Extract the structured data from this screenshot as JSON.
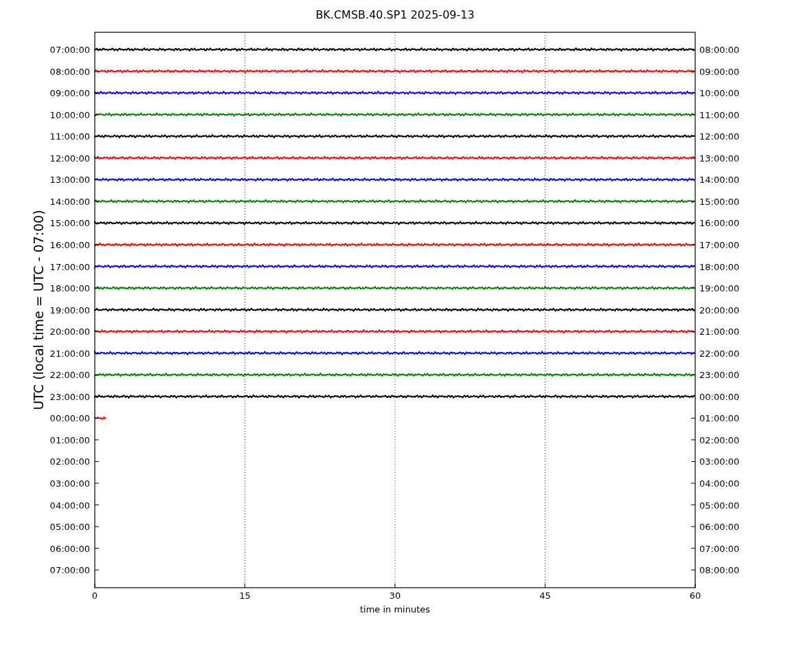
{
  "title": "BK.CMSB.40.SP1 2025-09-13",
  "ylabel": "UTC (local time = UTC - 07:00)",
  "xlabel": "time in minutes",
  "xticks": [
    "0",
    "15",
    "30",
    "45",
    "60"
  ],
  "left_ticks": [
    "07:00:00",
    "08:00:00",
    "09:00:00",
    "10:00:00",
    "11:00:00",
    "12:00:00",
    "13:00:00",
    "14:00:00",
    "15:00:00",
    "16:00:00",
    "17:00:00",
    "18:00:00",
    "19:00:00",
    "20:00:00",
    "21:00:00",
    "22:00:00",
    "23:00:00",
    "00:00:00",
    "01:00:00",
    "02:00:00",
    "03:00:00",
    "04:00:00",
    "05:00:00",
    "06:00:00",
    "07:00:00"
  ],
  "right_ticks": [
    "08:00:00",
    "09:00:00",
    "10:00:00",
    "11:00:00",
    "12:00:00",
    "13:00:00",
    "14:00:00",
    "15:00:00",
    "16:00:00",
    "17:00:00",
    "18:00:00",
    "19:00:00",
    "20:00:00",
    "21:00:00",
    "22:00:00",
    "23:00:00",
    "00:00:00",
    "01:00:00",
    "02:00:00",
    "03:00:00",
    "04:00:00",
    "05:00:00",
    "06:00:00",
    "07:00:00",
    "08:00:00"
  ],
  "traces": [
    {
      "color": "#000000",
      "level": 1
    },
    {
      "color": "#ff0000",
      "level": 1
    },
    {
      "color": "#0000ff",
      "level": 1
    },
    {
      "color": "#008000",
      "level": 1
    },
    {
      "color": "#000000",
      "level": 1
    },
    {
      "color": "#ff0000",
      "level": 1
    },
    {
      "color": "#0000ff",
      "level": 1
    },
    {
      "color": "#008000",
      "level": 1
    },
    {
      "color": "#000000",
      "level": 1
    },
    {
      "color": "#ff0000",
      "level": 1
    },
    {
      "color": "#0000ff",
      "level": 1
    },
    {
      "color": "#008000",
      "level": 1
    },
    {
      "color": "#000000",
      "level": 1
    },
    {
      "color": "#ff0000",
      "level": 1
    },
    {
      "color": "#0000ff",
      "level": 1
    },
    {
      "color": "#008000",
      "level": 1
    },
    {
      "color": "#000000",
      "level": 1
    },
    {
      "color": "#ff0000",
      "level": 0.02
    }
  ]
}
